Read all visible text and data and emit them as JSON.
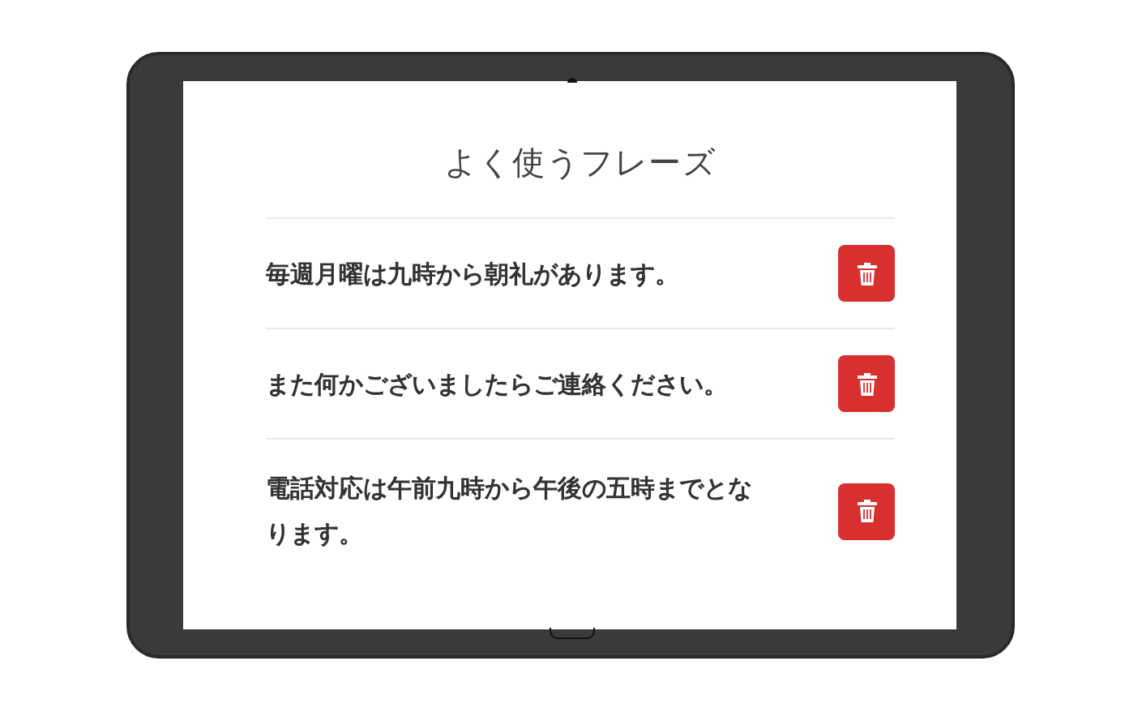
{
  "title": "よく使うフレーズ",
  "phrases": [
    {
      "text": "毎週月曜は九時から朝礼があります。"
    },
    {
      "text": "また何かございましたらご連絡ください。"
    },
    {
      "text": "電話対応は午前九時から午後の五時までとなります。"
    }
  ]
}
